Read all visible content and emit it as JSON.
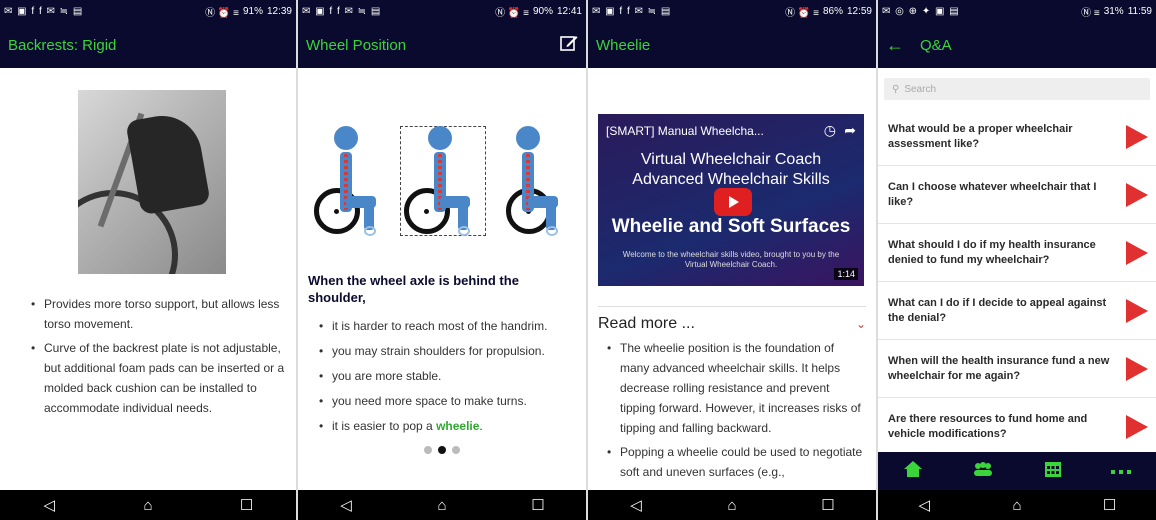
{
  "panels": {
    "backrests": {
      "status": {
        "left_icons": "✉ ▣ f f ✉ ≒ ▤",
        "right_icons": "Ⓝ ⏰ ≡",
        "battery": "91%",
        "time": "12:39"
      },
      "title": "Backrests: Rigid",
      "bullets": [
        "Provides more torso support, but allows less torso movement.",
        "Curve of the backrest plate is not adjustable, but additional foam pads can be inserted or a molded back cushion can be installed to accommodate individual needs."
      ]
    },
    "wheel_position": {
      "status": {
        "left_icons": "✉ ▣ f f ✉ ≒ ▤",
        "right_icons": "Ⓝ ⏰ ≡",
        "battery": "90%",
        "time": "12:41"
      },
      "title": "Wheel Position",
      "edit_icon": "edit-icon",
      "heading": "When the wheel axle is behind the shoulder,",
      "bullets": [
        "it is harder to reach most of the handrim.",
        "you may strain shoulders for propulsion.",
        "you are more stable.",
        "you need more space to make turns."
      ],
      "last_bullet_prefix": "it is easier to pop a ",
      "last_bullet_link": "wheelie",
      "last_bullet_suffix": ".",
      "page_indicator": {
        "count": 3,
        "active": 2
      }
    },
    "wheelie": {
      "status": {
        "left_icons": "✉ ▣ f f ✉ ≒ ▤",
        "right_icons": "Ⓝ ⏰ ≡",
        "battery": "86%",
        "time": "12:59"
      },
      "title": "Wheelie",
      "video": {
        "channel_title": "[SMART] Manual Wheelcha...",
        "line1": "Virtual Wheelchair Coach",
        "line2": "Advanced Wheelchair Skills",
        "big_title": "Wheelie and Soft Surfaces",
        "caption": "Welcome to the wheelchair skills video, brought to you by the Virtual Wheelchair Coach.",
        "duration": "1:14"
      },
      "read_more": "Read more ...",
      "bullets": [
        "The wheelie position is the foundation of many advanced wheelchair skills. It helps decrease rolling resistance and prevent tipping forward. However, it increases risks of tipping and falling backward.",
        "Popping a wheelie could be used to negotiate soft and uneven surfaces (e.g.,"
      ]
    },
    "qa": {
      "status": {
        "left_icons": "✉ ◎ ⊕ ✦ ▣ ▤",
        "right_icons": "Ⓝ ≡",
        "battery": "31%",
        "time": "11:59"
      },
      "title": "Q&A",
      "search_placeholder": "Search",
      "questions": [
        "What would be a proper wheelchair assessment like?",
        "Can I choose whatever wheelchair that I like?",
        "What should I do if my health insurance denied to fund my wheelchair?",
        "What can I do if I decide to appeal against the denial?",
        "When will the health insurance fund a new wheelchair for me again?",
        "Are there resources to fund home and vehicle modifications?"
      ],
      "tabs": [
        "home-icon",
        "group-icon",
        "calendar-icon",
        "more-icon"
      ]
    }
  },
  "colors": {
    "bar": "#0a0a2e",
    "accent": "#3bd43b",
    "arrow": "#e03030",
    "figure": "#4a87c8"
  }
}
